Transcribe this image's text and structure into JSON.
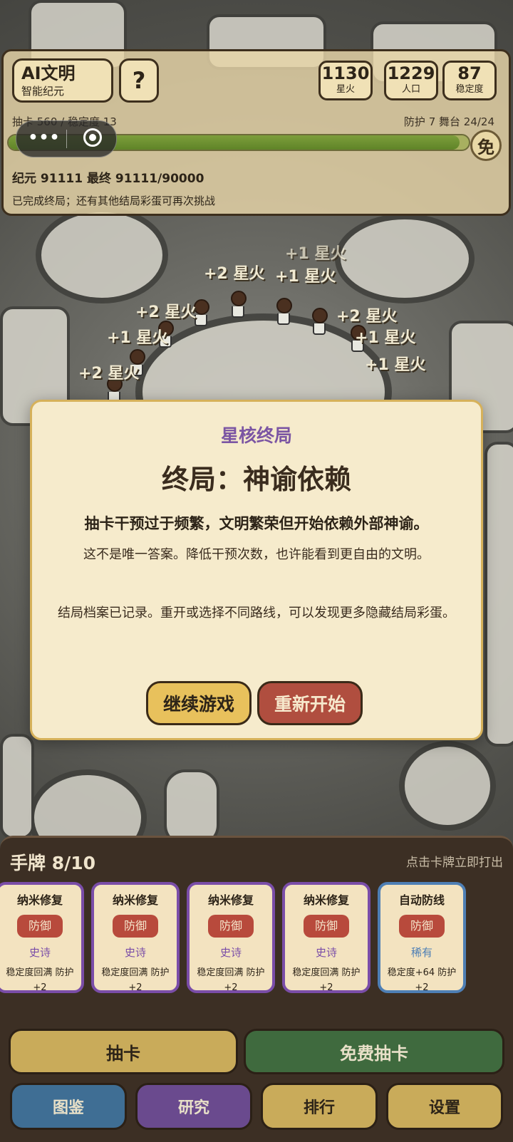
{
  "hud": {
    "civ_name": "AI文明",
    "era": "智能纪元",
    "help_label": "?",
    "stats": [
      {
        "value": "1130",
        "label": "星火"
      },
      {
        "value": "1229",
        "label": "人口"
      },
      {
        "value": "87",
        "label": "稳定度"
      }
    ],
    "draws_line": "抽卡 560 / 稳定度 13",
    "defense_line": "防护 7  舞台 24/24",
    "progress": 0.98,
    "free_badge": "免",
    "era_line": "纪元 91111   最终 91111/90000",
    "status_line": "已完成终局；还有其他结局彩蛋可再次挑战"
  },
  "capsule": {
    "more_icon": "•••"
  },
  "floaters": [
    "+2 星火",
    "+1 星火",
    "+1 星火",
    "+2 星火",
    "+1 星火",
    "+2 星火",
    "+1 星火",
    "+2 星火",
    "+1 星火"
  ],
  "modal": {
    "subtitle": "星核终局",
    "title": "终局：神谕依赖",
    "description": "抽卡干预过于频繁，文明繁荣但开始依赖外部神谕。",
    "hint": "这不是唯一答案。降低干预次数，也许能看到更自由的文明。",
    "archive": "结局档案已记录。重开或选择不同路线，可以发现更多隐藏结局彩蛋。",
    "continue_label": "继续游戏",
    "restart_label": "重新开始"
  },
  "hand": {
    "title": "手牌 8/10",
    "hint": "点击卡牌立即打出",
    "cards": [
      {
        "name": "纳米修复",
        "type": "防御",
        "rarity": "史诗",
        "desc": "稳定度回满 防护+2"
      },
      {
        "name": "纳米修复",
        "type": "防御",
        "rarity": "史诗",
        "desc": "稳定度回满 防护+2"
      },
      {
        "name": "纳米修复",
        "type": "防御",
        "rarity": "史诗",
        "desc": "稳定度回满 防护+2"
      },
      {
        "name": "纳米修复",
        "type": "防御",
        "rarity": "史诗",
        "desc": "稳定度回满 防护+2"
      },
      {
        "name": "自动防线",
        "type": "防御",
        "rarity": "稀有",
        "desc": "稳定度+64 防护+2"
      }
    ]
  },
  "actions": {
    "draw": "抽卡",
    "free_draw": "免费抽卡"
  },
  "nav": {
    "codex": "图鉴",
    "research": "研究",
    "ranking": "排行",
    "settings": "设置"
  },
  "colors": {
    "modal_subtitle": "#7b55a3",
    "continue_bg": "#e8c15c",
    "restart_bg": "#b04e3f",
    "draw_bg": "#c9ab5a",
    "free_draw_bg": "#3f6a3e",
    "epic": "#7a4da8",
    "rare": "#4e7fb5"
  }
}
